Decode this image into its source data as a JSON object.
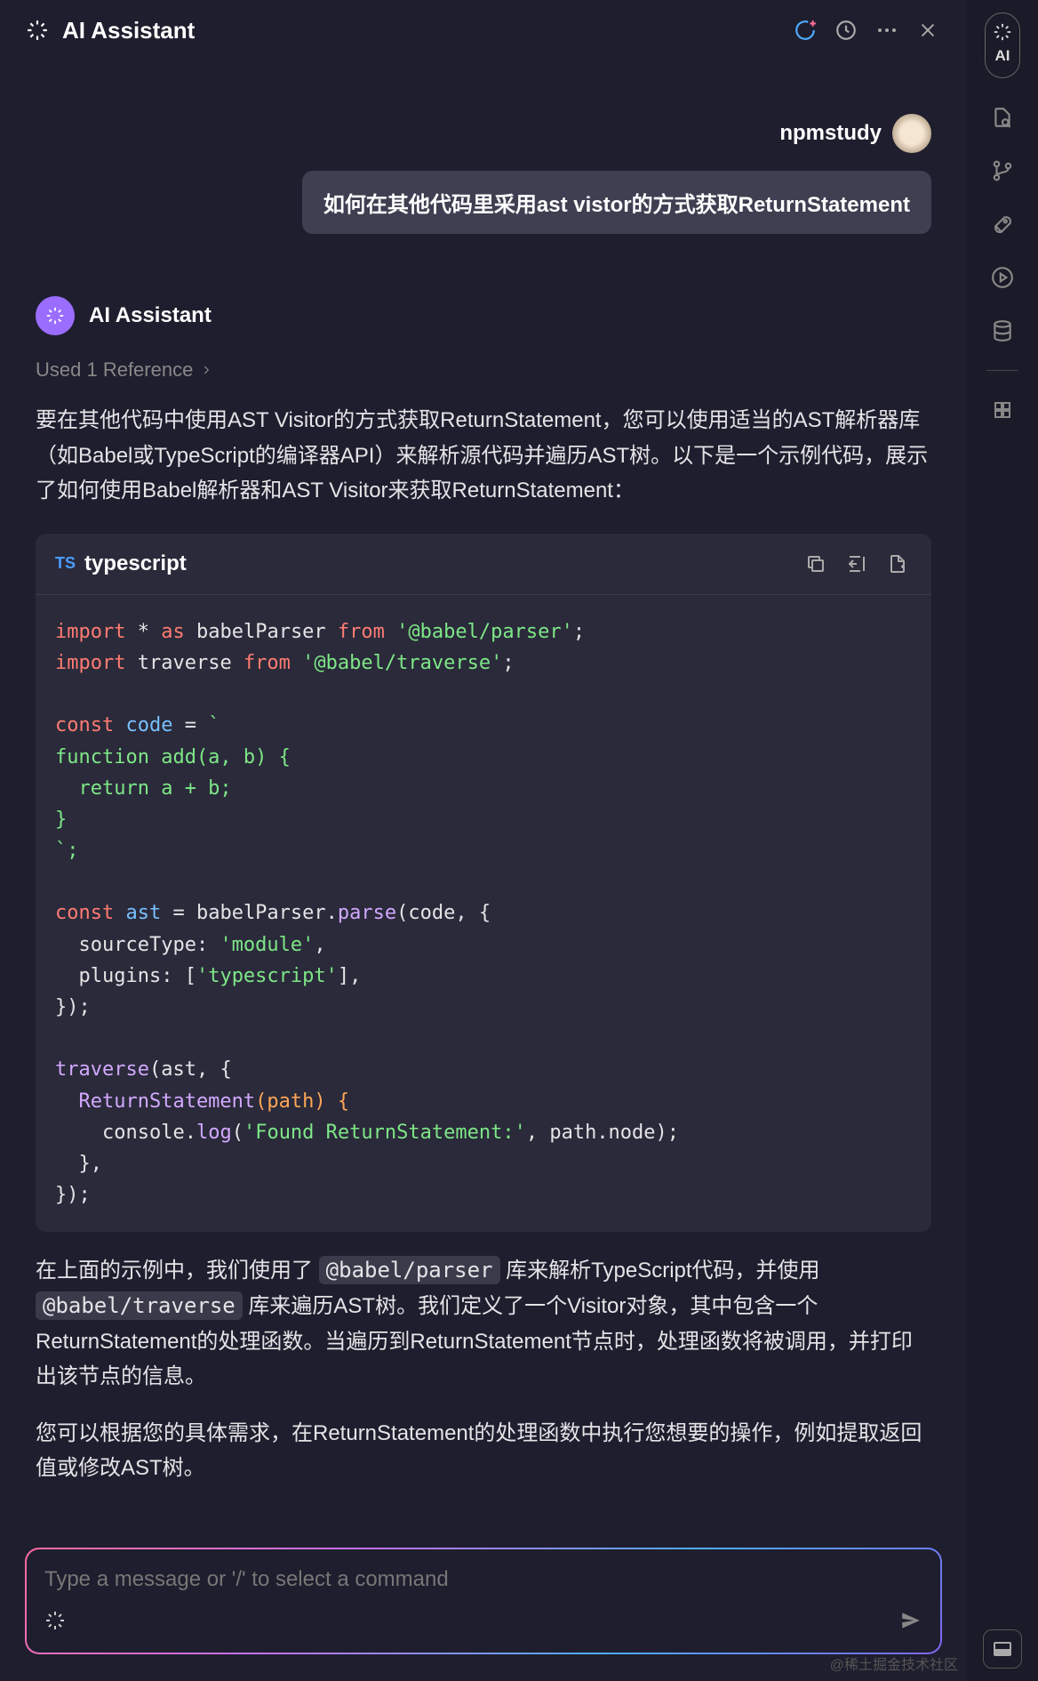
{
  "header": {
    "title": "AI Assistant"
  },
  "user": {
    "name": "npmstudy",
    "message": "如何在其他代码里采用ast vistor的方式获取ReturnStatement"
  },
  "assistant": {
    "name": "AI Assistant",
    "reference_text": "Used 1 Reference",
    "para1": "要在其他代码中使用AST Visitor的方式获取ReturnStatement，您可以使用适当的AST解析器库（如Babel或TypeScript的编译器API）来解析源代码并遍历AST树。以下是一个示例代码，展示了如何使用Babel解析器和AST Visitor来获取ReturnStatement：",
    "code": {
      "badge": "TS",
      "language": "typescript",
      "line1_import": "import",
      "line1_star": " * ",
      "line1_as": "as",
      "line1_name": " babelParser ",
      "line1_from": "from",
      "line1_str": " '@babel/parser'",
      "line1_end": ";",
      "line2_import": "import",
      "line2_name": " traverse ",
      "line2_from": "from",
      "line2_str": " '@babel/traverse'",
      "line2_end": ";",
      "line4_const": "const",
      "line4_name": " code ",
      "line4_eq": "= ",
      "line4_tick": "`",
      "line5": "function add(a, b) {",
      "line6": "  return a + b;",
      "line7": "}",
      "line8": "`;",
      "line10_const": "const",
      "line10_name": " ast ",
      "line10_eq": "= babelParser.",
      "line10_fn": "parse",
      "line10_open": "(code, {",
      "line11_key": "  sourceType: ",
      "line11_val": "'module'",
      "line11_end": ",",
      "line12_key": "  plugins: [",
      "line12_val": "'typescript'",
      "line12_end": "],",
      "line13": "});",
      "line15_fn": "traverse",
      "line15_open": "(ast, {",
      "line16_fn": "  ReturnStatement",
      "line16_args": "(path) {",
      "line17_pre": "    console.",
      "line17_fn": "log",
      "line17_open": "(",
      "line17_str": "'Found ReturnStatement:'",
      "line17_rest": ", path.node);",
      "line18": "  },",
      "line19": "});"
    },
    "para2_a": "在上面的示例中，我们使用了 ",
    "chip1": "@babel/parser",
    "para2_b": " 库来解析TypeScript代码，并使用 ",
    "chip2": "@babel/traverse",
    "para2_c": " 库来遍历AST树。我们定义了一个Visitor对象，其中包含一个ReturnStatement的处理函数。当遍历到ReturnStatement节点时，处理函数将被调用，并打印出该节点的信息。",
    "para3": "您可以根据您的具体需求，在ReturnStatement的处理函数中执行您想要的操作，例如提取返回值或修改AST树。"
  },
  "input": {
    "placeholder": "Type a message or '/' to select a command"
  },
  "sidebar": {
    "ai_label": "AI"
  },
  "watermark": "@稀土掘金技术社区"
}
